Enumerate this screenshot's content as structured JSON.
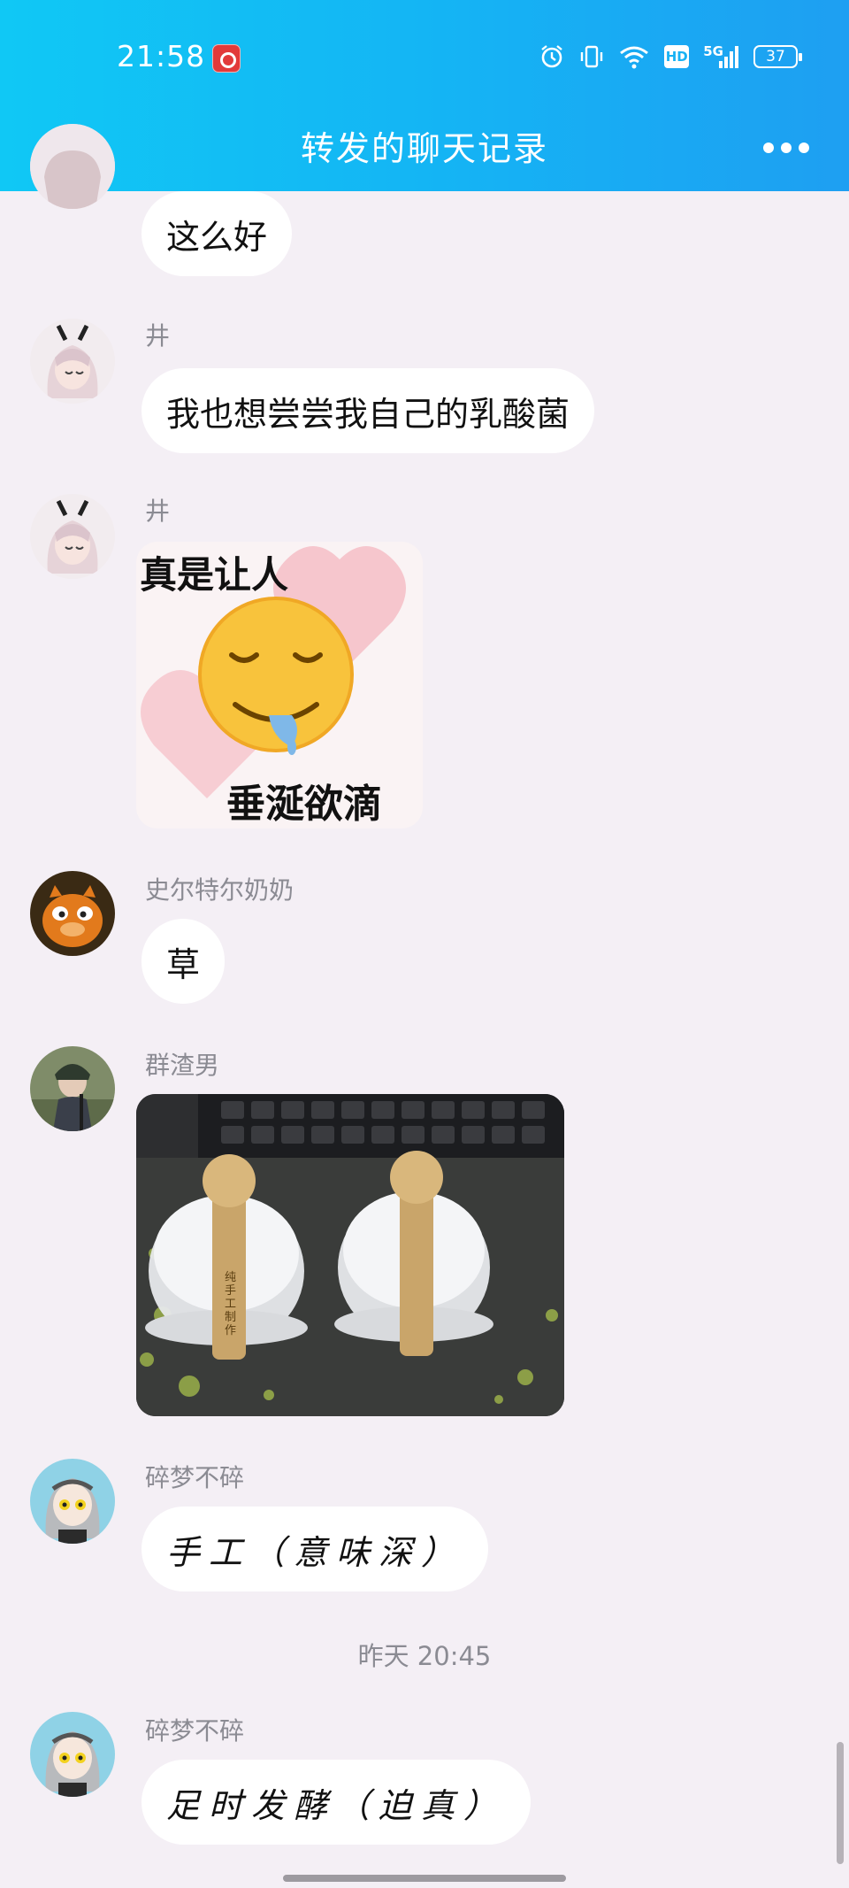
{
  "status": {
    "time": "21:58",
    "icons": [
      "alarm-icon",
      "vibrate-icon",
      "wifi-icon",
      "hd-icon",
      "signal-5g-icon"
    ],
    "hd_label": "HD",
    "network_label": "5G",
    "battery": "37"
  },
  "nav": {
    "title": "转发的聊天记录",
    "back_icon": "chevron-left-icon",
    "more_icon": "more-dots-icon"
  },
  "messages": [
    {
      "sender": "",
      "text": "这么好",
      "type": "text"
    },
    {
      "sender": "井",
      "text": "我也想尝尝我自己的乳酸菌",
      "type": "text"
    },
    {
      "sender": "井",
      "type": "sticker",
      "caption_top": "真是让人",
      "caption_bottom": "垂涎欲滴"
    },
    {
      "sender": "史尔特尔奶奶",
      "text": "草",
      "type": "text"
    },
    {
      "sender": "群渣男",
      "type": "photo",
      "label_text": "纯手工制作"
    },
    {
      "sender": "碎梦不碎",
      "text": "手工（意味深）",
      "type": "text"
    }
  ],
  "divider": {
    "time": "昨天 20:45"
  },
  "last_message": {
    "sender": "碎梦不碎",
    "text": "足时发酵（迫真）",
    "type": "text"
  },
  "colors": {
    "header_start": "#10c8f5",
    "header_end": "#1e9ff2",
    "background": "#f4eff5",
    "bubble": "#ffffff",
    "sender_text": "#8b8b93"
  }
}
